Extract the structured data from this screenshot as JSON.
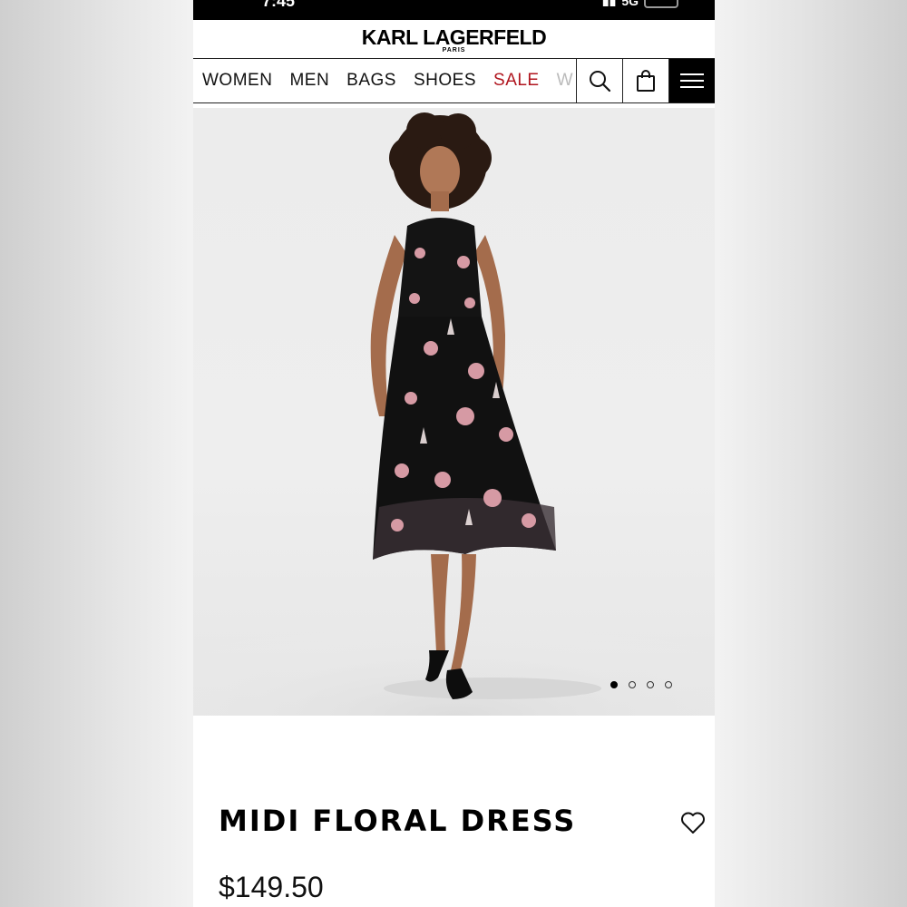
{
  "status": {
    "time": "7:45",
    "network": "5G"
  },
  "brand": {
    "name": "KARL LAGERFELD",
    "subtitle": "PARIS"
  },
  "nav": {
    "links": [
      {
        "label": "WOMEN"
      },
      {
        "label": "MEN"
      },
      {
        "label": "BAGS"
      },
      {
        "label": "SHOES"
      },
      {
        "label": "SALE"
      },
      {
        "label": "W"
      }
    ],
    "icons": {
      "search": "search-icon",
      "bag": "shopping-bag-icon",
      "menu": "hamburger-menu-icon"
    },
    "sale_color": "#b0151e"
  },
  "gallery": {
    "image_count": 4,
    "active_index": 0
  },
  "product": {
    "title": "MIDI FLORAL DRESS",
    "price": "$149.50",
    "wishlist_icon": "heart-icon"
  }
}
